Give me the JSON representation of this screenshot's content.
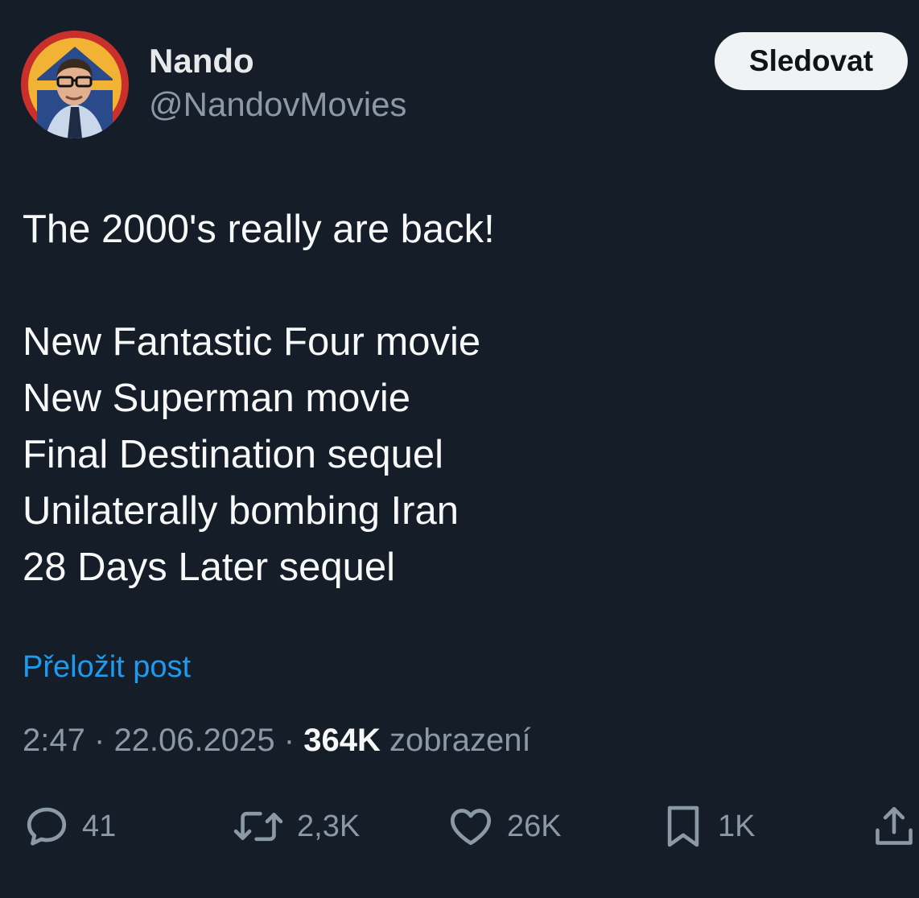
{
  "author": {
    "display_name": "Nando",
    "handle": "@NandovMovies",
    "avatar_icon": "profile-photo"
  },
  "follow_button": {
    "label": "Sledovat"
  },
  "tweet": {
    "lines": [
      "The 2000's really are back!",
      "",
      "New Fantastic Four movie",
      "New Superman movie",
      "Final Destination sequel",
      "Unilaterally bombing Iran",
      "28 Days Later sequel"
    ]
  },
  "translate_link": "Přeložit post",
  "meta": {
    "time": "2:47",
    "separator": "·",
    "date": "22.06.2025",
    "views_count": "364K",
    "views_label": "zobrazení"
  },
  "actions": {
    "replies": {
      "icon": "reply-icon",
      "count": "41"
    },
    "reposts": {
      "icon": "repost-icon",
      "count": "2,3K"
    },
    "likes": {
      "icon": "heart-icon",
      "count": "26K"
    },
    "bookmarks": {
      "icon": "bookmark-icon",
      "count": "1K"
    },
    "share": {
      "icon": "share-icon"
    }
  },
  "colors": {
    "background": "#151d28",
    "text": "#f7f9f9",
    "muted": "#8b98a5",
    "link": "#1d9bf0",
    "button_bg": "#eff3f4"
  }
}
